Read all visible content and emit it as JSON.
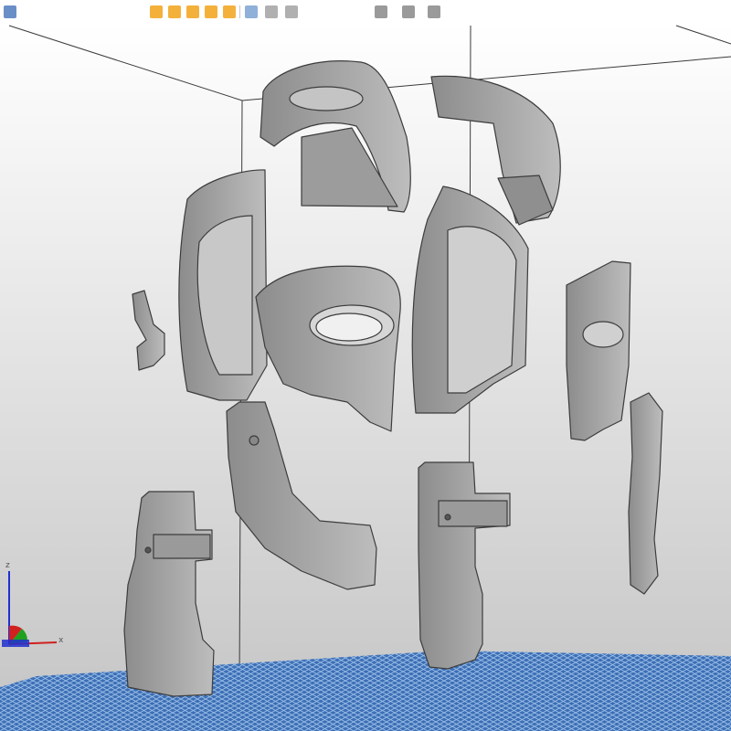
{
  "toolbar": {
    "buttons": [
      {
        "name": "menu-icon",
        "color": "#6a8fc7"
      },
      {
        "name": "open-icon",
        "color": "#f3b13c"
      },
      {
        "name": "save-icon",
        "color": "#f3b13c"
      },
      {
        "name": "undo-icon",
        "color": "#f3b13c"
      },
      {
        "name": "redo-icon",
        "color": "#f3b13c"
      },
      {
        "name": "select-icon",
        "color": "#f3b13c"
      },
      {
        "name": "move-icon",
        "color": "#8fb0d8"
      },
      {
        "name": "rotate-icon",
        "color": "#b0b0b0"
      },
      {
        "name": "scale-icon",
        "color": "#b0b0b0"
      },
      {
        "name": "cut-icon",
        "color": "#9a9a9a"
      },
      {
        "name": "view-icon",
        "color": "#9a9a9a"
      },
      {
        "name": "settings-icon",
        "color": "#9a9a9a"
      }
    ]
  },
  "viewport": {
    "background_top": "#ffffff",
    "background_bottom": "#c4c4c4",
    "part_color": "#a9a9a9",
    "build_plate_color": "#3d6fb6"
  },
  "axes": {
    "x_label": "x",
    "z_label": "z",
    "x_color": "#d02020",
    "y_color": "#20a020",
    "z_color": "#2030d0"
  }
}
